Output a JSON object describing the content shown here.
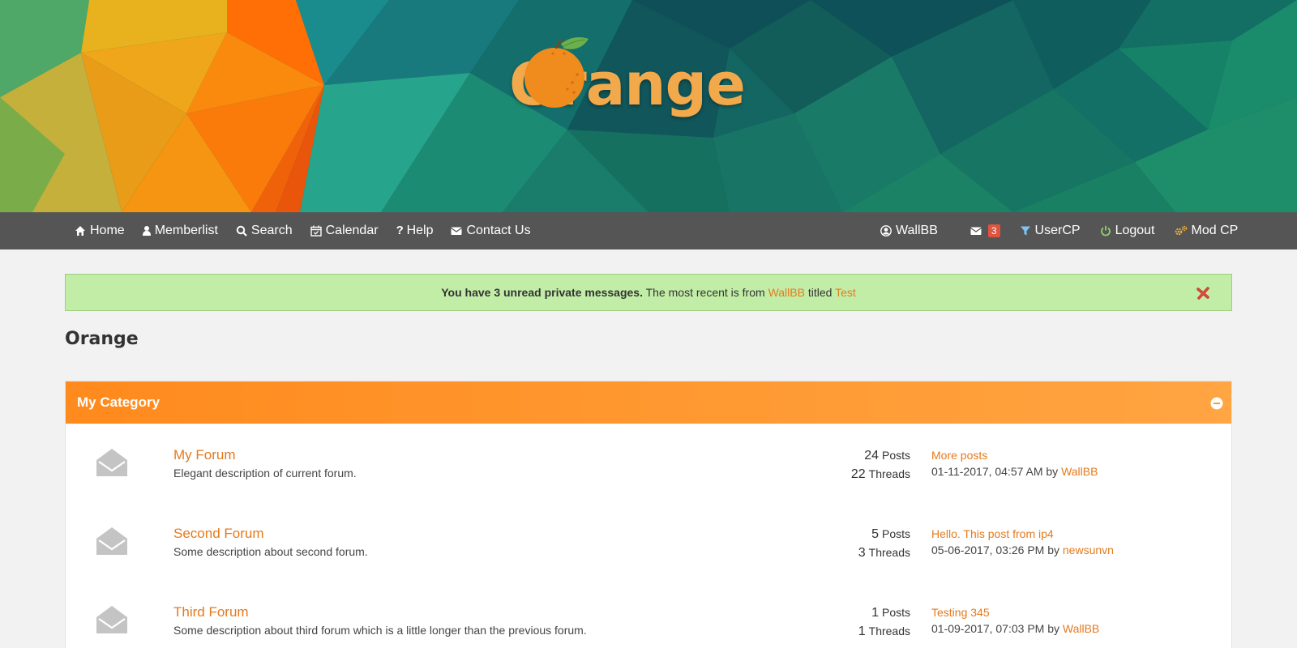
{
  "banner": {
    "logo_text": "Orange",
    "logo_icon": "orange-fruit-icon"
  },
  "navbar": {
    "left": [
      {
        "label": "Home",
        "icon": "home-icon"
      },
      {
        "label": "Memberlist",
        "icon": "user-icon"
      },
      {
        "label": "Search",
        "icon": "search-icon"
      },
      {
        "label": "Calendar",
        "icon": "calendar-icon"
      },
      {
        "label": "Help",
        "icon": "question-icon"
      },
      {
        "label": "Contact Us",
        "icon": "envelope-icon"
      }
    ],
    "right": {
      "username": "WallBB",
      "pm_count": "3",
      "usercp": "UserCP",
      "logout": "Logout",
      "modcp": "Mod CP"
    }
  },
  "pm_alert": {
    "bold_text": "You have 3 unread private messages.",
    "text_before_sender": "The most recent is from",
    "sender": "WallBB",
    "text_titled": "titled",
    "title": "Test"
  },
  "page_title": "Orange",
  "category": {
    "title": "My Category",
    "forums": [
      {
        "name": "My Forum",
        "description": "Elegant description of current forum.",
        "posts": "24",
        "posts_label": "Posts",
        "threads": "22",
        "threads_label": "Threads",
        "lastpost_subject": "More posts",
        "lastpost_date": "01-11-2017, 04:57 AM by",
        "lastpost_author": "WallBB"
      },
      {
        "name": "Second Forum",
        "description": "Some description about second forum.",
        "posts": "5",
        "posts_label": "Posts",
        "threads": "3",
        "threads_label": "Threads",
        "lastpost_subject": "Hello. This post from ip4",
        "lastpost_date": "05-06-2017, 03:26 PM by",
        "lastpost_author": "newsunvn"
      },
      {
        "name": "Third Forum",
        "description": "Some description about third forum which is a little longer than the previous forum.",
        "posts": "1",
        "posts_label": "Posts",
        "threads": "1",
        "threads_label": "Threads",
        "lastpost_subject": "Testing 345",
        "lastpost_date": "01-09-2017, 07:03 PM by",
        "lastpost_author": "WallBB"
      }
    ]
  },
  "colors": {
    "accent": "#e57a1c",
    "navbar_bg": "#555555",
    "alert_bg": "#c2eda7",
    "category_header": "#ff8a1d"
  }
}
